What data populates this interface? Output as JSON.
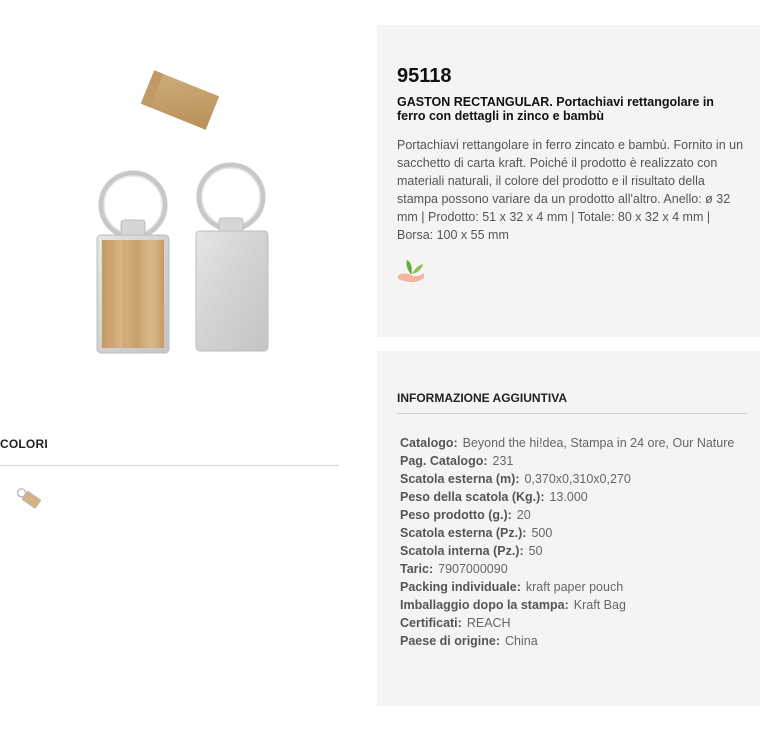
{
  "product": {
    "sku": "95118",
    "title": "GASTON RECTANGULAR. Portachiavi rettangolare in ferro con dettagli in zinco e bambù",
    "description": "Portachiavi rettangolare in ferro zincato e bambù. Fornito in un sacchetto di carta kraft. Poiché il prodotto è realizzato con materiali naturali, il colore del prodotto e il risultato della stampa possono variare da un prodotto all'altro. Anello: ø 32 mm | Prodotto: 51 x 32 x 4 mm | Totale: 80 x 32 x 4 mm | Borsa: 100 x 55 mm",
    "eco_icon": "leaf-hand-icon"
  },
  "colors": {
    "title": "COLORI",
    "swatches": [
      {
        "name": "natural",
        "color": "#d6b382"
      }
    ]
  },
  "info": {
    "title": "INFORMAZIONE AGGIUNTIVA",
    "rows": [
      {
        "label": "Catalogo:",
        "value": "Beyond the hi!dea, Stampa in 24 ore, Our Nature"
      },
      {
        "label": "Pag. Catalogo:",
        "value": "231"
      },
      {
        "label": "Scatola esterna (m):",
        "value": "0,370x0,310x0,270"
      },
      {
        "label": "Peso della scatola (Kg.):",
        "value": "13.000"
      },
      {
        "label": "Peso prodotto (g.):",
        "value": "20"
      },
      {
        "label": "Scatola esterna (Pz.):",
        "value": "500"
      },
      {
        "label": "Scatola interna (Pz.):",
        "value": "50"
      },
      {
        "label": "Taric:",
        "value": "7907000090"
      },
      {
        "label": "Packing individuale:",
        "value": "kraft paper pouch"
      },
      {
        "label": "Imballaggio dopo la stampa:",
        "value": "Kraft Bag"
      },
      {
        "label": "Certificati:",
        "value": "REACH"
      },
      {
        "label": "Paese di origine:",
        "value": "China"
      }
    ]
  }
}
